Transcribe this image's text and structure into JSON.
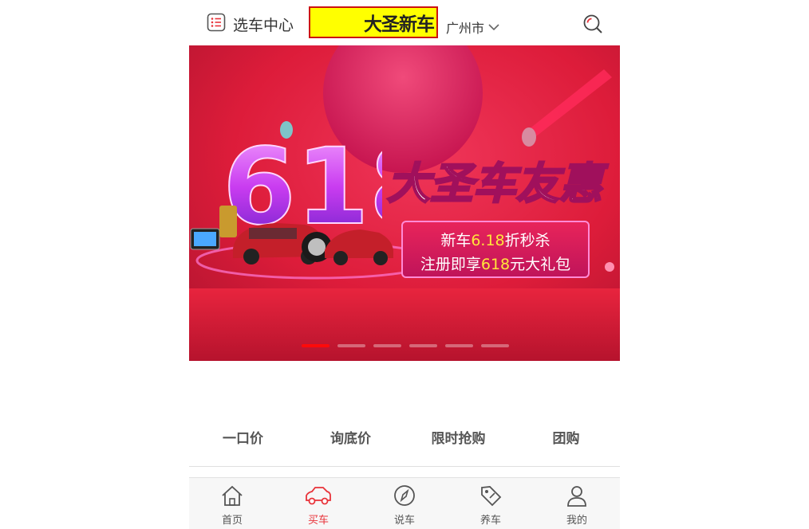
{
  "header": {
    "select_center_label": "选车中心",
    "brand_name": "大圣新车",
    "city": "广州市"
  },
  "banner": {
    "big_number": "618",
    "headline": "大圣车友惠",
    "promo_line1_prefix": "新车",
    "promo_line1_highlight": "6.18",
    "promo_line1_suffix": "折秒杀",
    "promo_line2_prefix": "注册即享",
    "promo_line2_highlight": "618",
    "promo_line2_suffix": "元大礼包",
    "active_slide_index": 0,
    "slide_count": 6
  },
  "categories": [
    "一口价",
    "询底价",
    "限时抢购",
    "团购"
  ],
  "nav": {
    "items": [
      {
        "label": "首页",
        "icon": "home-icon",
        "active": false
      },
      {
        "label": "买车",
        "icon": "car-icon",
        "active": true
      },
      {
        "label": "说车",
        "icon": "compass-icon",
        "active": false
      },
      {
        "label": "养车",
        "icon": "tag-icon",
        "active": false
      },
      {
        "label": "我的",
        "icon": "user-icon",
        "active": false
      }
    ]
  },
  "colors": {
    "accent": "#e8333a",
    "brand_box_bg": "#ffff00",
    "brand_box_border": "#cc1111",
    "banner_bg": "#e0203c",
    "promo_highlight": "#ffe53b"
  }
}
